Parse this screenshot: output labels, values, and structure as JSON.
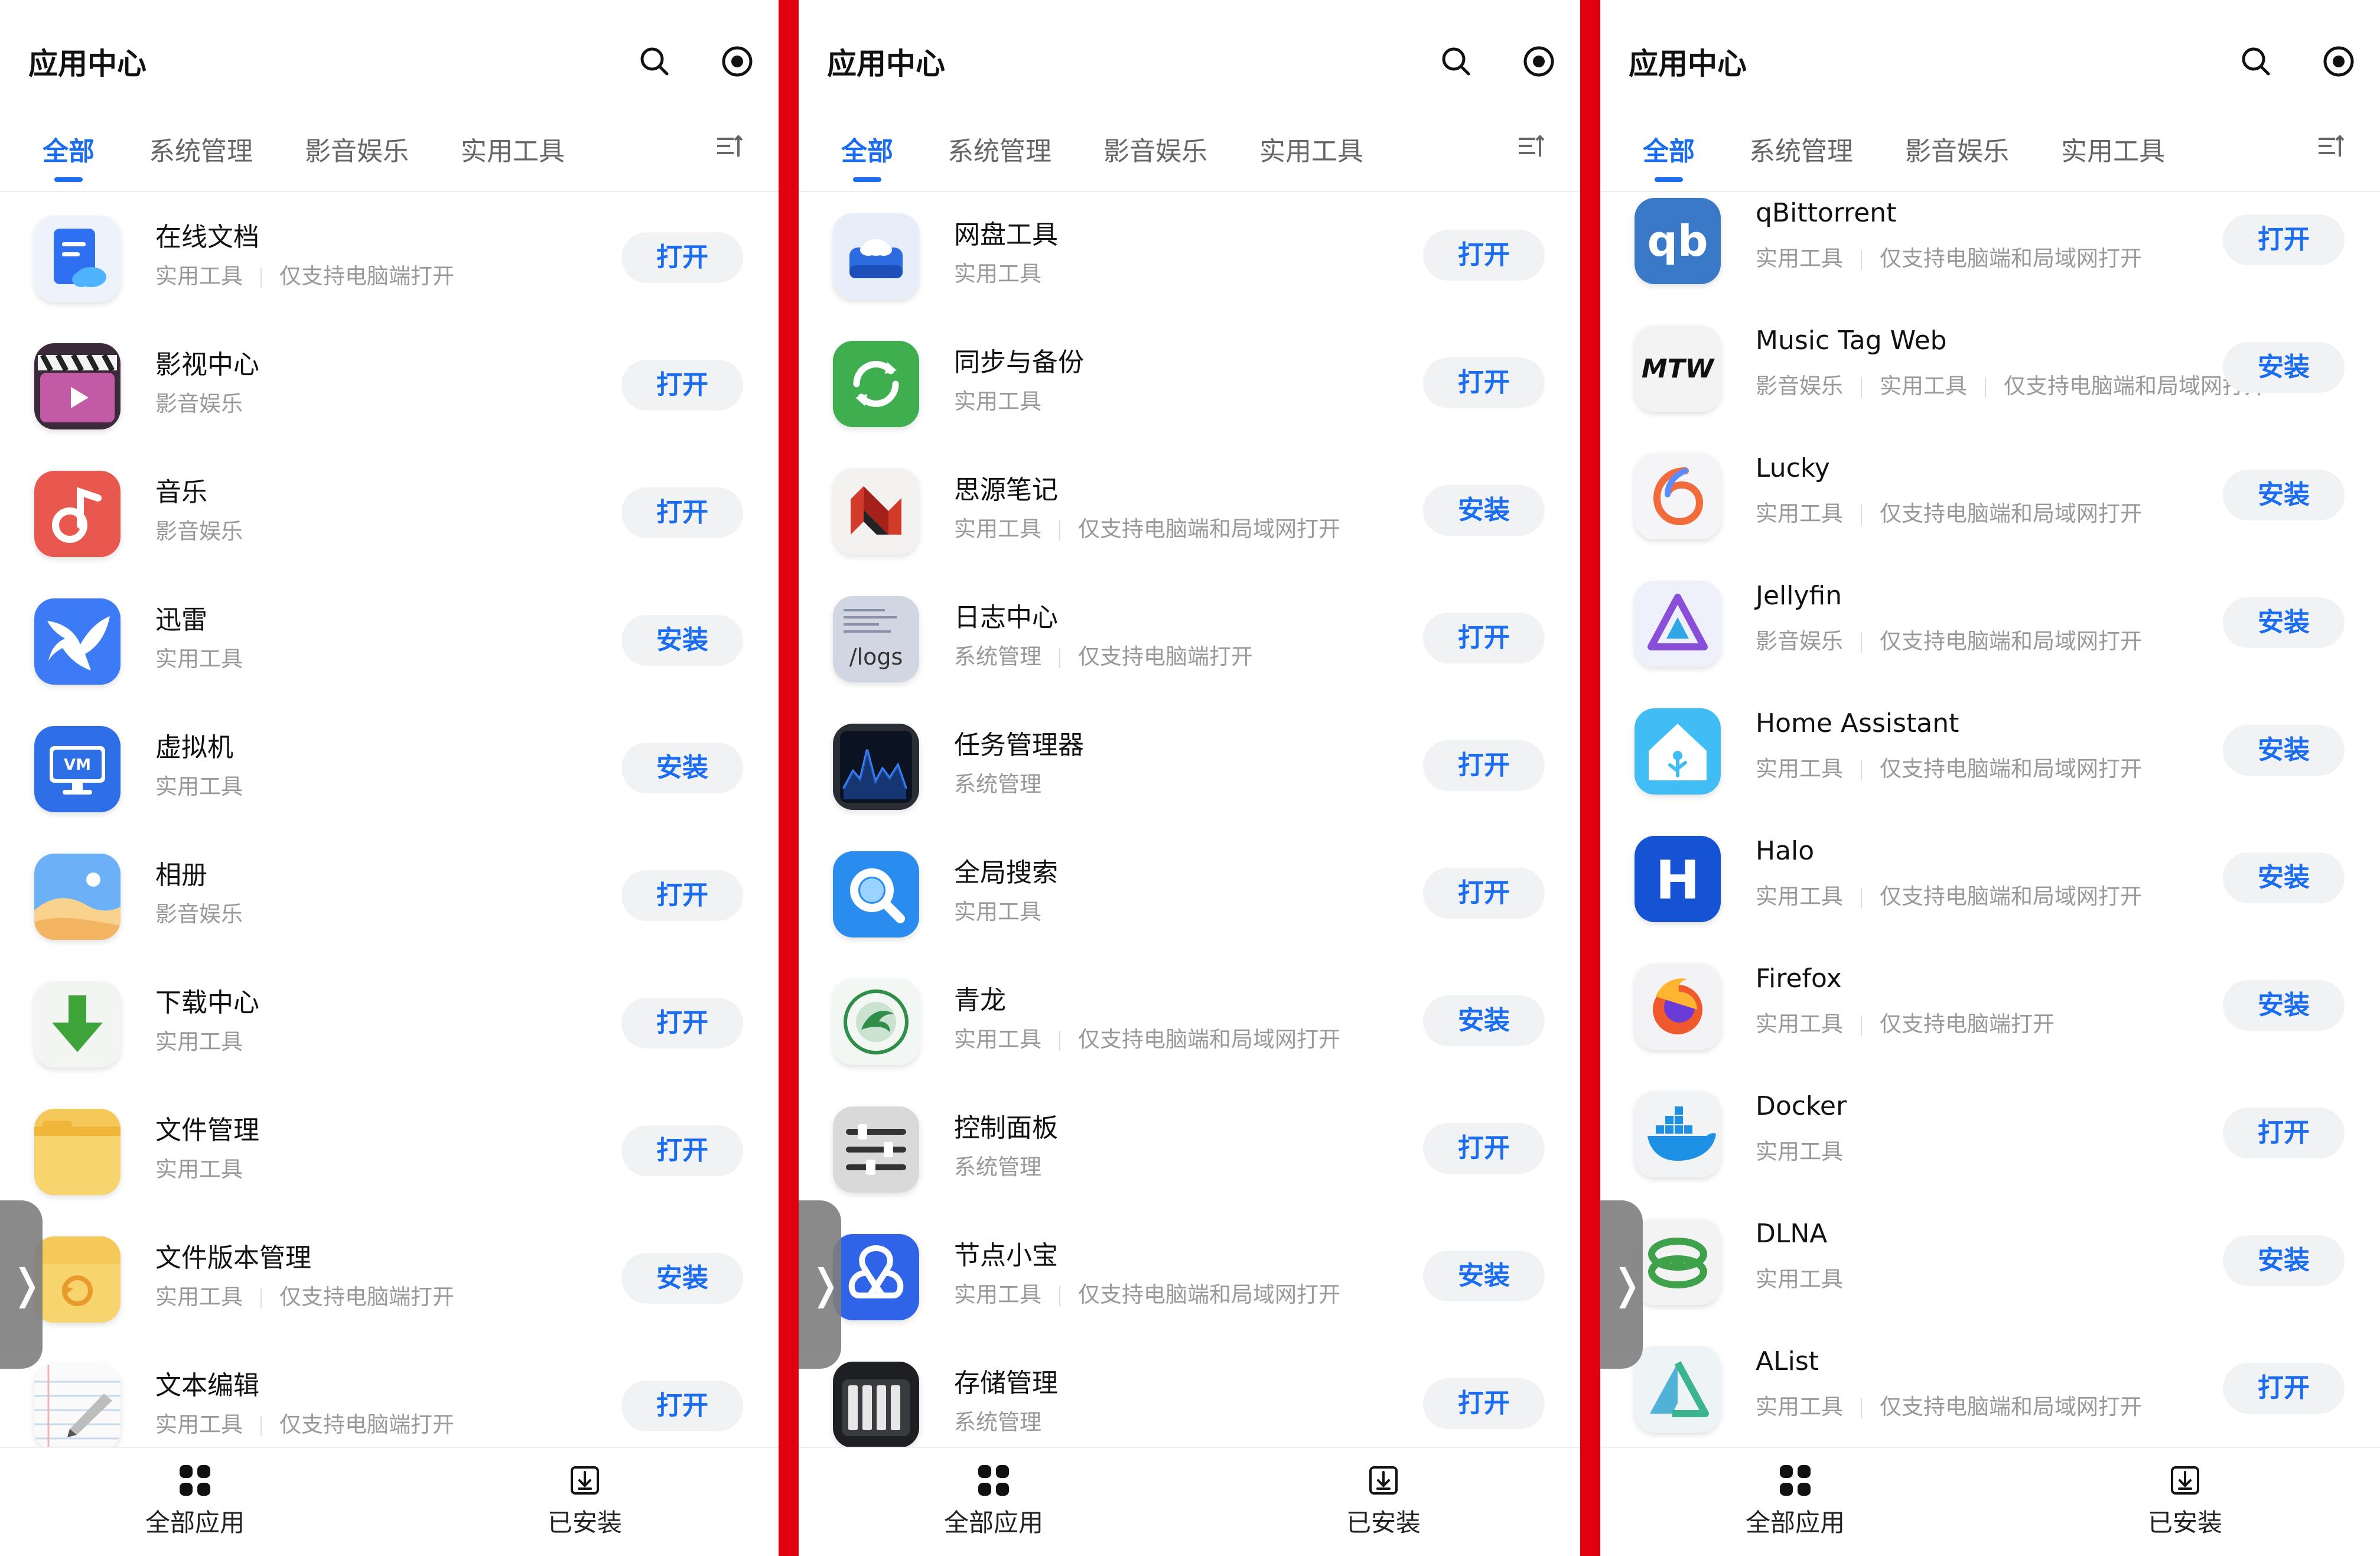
{
  "panels": [
    {
      "title": "应用中心",
      "tabs": [
        "全部",
        "系统管理",
        "影音娱乐",
        "实用工具"
      ],
      "apps": [
        {
          "name": "在线文档",
          "meta": [
            "实用工具",
            "仅支持电脑端打开"
          ],
          "button": "打开",
          "icon": "doc-icon"
        },
        {
          "name": "影视中心",
          "meta": [
            "影音娱乐"
          ],
          "button": "打开",
          "icon": "video-icon"
        },
        {
          "name": "音乐",
          "meta": [
            "影音娱乐"
          ],
          "button": "打开",
          "icon": "music-icon"
        },
        {
          "name": "迅雷",
          "meta": [
            "实用工具"
          ],
          "button": "安装",
          "icon": "thunder-bird-icon"
        },
        {
          "name": "虚拟机",
          "meta": [
            "实用工具"
          ],
          "button": "安装",
          "icon": "vm-icon"
        },
        {
          "name": "相册",
          "meta": [
            "影音娱乐"
          ],
          "button": "打开",
          "icon": "photo-icon"
        },
        {
          "name": "下载中心",
          "meta": [
            "实用工具"
          ],
          "button": "打开",
          "icon": "download-arrow-icon"
        },
        {
          "name": "文件管理",
          "meta": [
            "实用工具"
          ],
          "button": "打开",
          "icon": "folder-icon"
        },
        {
          "name": "文件版本管理",
          "meta": [
            "实用工具",
            "仅支持电脑端打开"
          ],
          "button": "安装",
          "icon": "folder-history-icon"
        },
        {
          "name": "文本编辑",
          "meta": [
            "实用工具",
            "仅支持电脑端打开"
          ],
          "button": "打开",
          "icon": "notepad-icon"
        }
      ]
    },
    {
      "title": "应用中心",
      "tabs": [
        "全部",
        "系统管理",
        "影音娱乐",
        "实用工具"
      ],
      "apps": [
        {
          "name": "网盘工具",
          "meta": [
            "实用工具"
          ],
          "button": "打开",
          "icon": "cloud-drive-icon"
        },
        {
          "name": "同步与备份",
          "meta": [
            "实用工具"
          ],
          "button": "打开",
          "icon": "sync-icon"
        },
        {
          "name": "思源笔记",
          "meta": [
            "实用工具",
            "仅支持电脑端和局域网打开"
          ],
          "button": "安装",
          "icon": "siyuan-icon"
        },
        {
          "name": "日志中心",
          "meta": [
            "系统管理",
            "仅支持电脑端打开"
          ],
          "button": "打开",
          "icon": "logs-icon",
          "icon_text": "/logs"
        },
        {
          "name": "任务管理器",
          "meta": [
            "系统管理"
          ],
          "button": "打开",
          "icon": "activity-monitor-icon"
        },
        {
          "name": "全局搜索",
          "meta": [
            "实用工具"
          ],
          "button": "打开",
          "icon": "search-app-icon"
        },
        {
          "name": "青龙",
          "meta": [
            "实用工具",
            "仅支持电脑端和局域网打开"
          ],
          "button": "安装",
          "icon": "qinglong-icon"
        },
        {
          "name": "控制面板",
          "meta": [
            "系统管理"
          ],
          "button": "打开",
          "icon": "sliders-icon"
        },
        {
          "name": "节点小宝",
          "meta": [
            "实用工具",
            "仅支持电脑端和局域网打开"
          ],
          "button": "安装",
          "icon": "node-icon"
        },
        {
          "name": "存储管理",
          "meta": [
            "系统管理"
          ],
          "button": "打开",
          "icon": "storage-icon"
        }
      ]
    },
    {
      "title": "应用中心",
      "tabs": [
        "全部",
        "系统管理",
        "影音娱乐",
        "实用工具"
      ],
      "apps": [
        {
          "name": "qBittorrent",
          "meta": [
            "实用工具",
            "仅支持电脑端和局域网打开"
          ],
          "button": "打开",
          "icon": "qbittorrent-icon",
          "icon_text": "qb"
        },
        {
          "name": "Music Tag Web",
          "meta": [
            "影音娱乐",
            "实用工具",
            "仅支持电脑端和局域网打开"
          ],
          "button": "安装",
          "icon": "music-tag-icon",
          "icon_text": "MTW"
        },
        {
          "name": "Lucky",
          "meta": [
            "实用工具",
            "仅支持电脑端和局域网打开"
          ],
          "button": "安装",
          "icon": "lucky-icon"
        },
        {
          "name": "Jellyfin",
          "meta": [
            "影音娱乐",
            "仅支持电脑端和局域网打开"
          ],
          "button": "安装",
          "icon": "jellyfin-icon"
        },
        {
          "name": "Home Assistant",
          "meta": [
            "实用工具",
            "仅支持电脑端和局域网打开"
          ],
          "button": "安装",
          "icon": "home-assistant-icon"
        },
        {
          "name": "Halo",
          "meta": [
            "实用工具",
            "仅支持电脑端和局域网打开"
          ],
          "button": "安装",
          "icon": "halo-icon",
          "icon_text": "H"
        },
        {
          "name": "Firefox",
          "meta": [
            "实用工具",
            "仅支持电脑端打开"
          ],
          "button": "安装",
          "icon": "firefox-icon"
        },
        {
          "name": "Docker",
          "meta": [
            "实用工具"
          ],
          "button": "打开",
          "icon": "docker-icon"
        },
        {
          "name": "DLNA",
          "meta": [
            "实用工具"
          ],
          "button": "安装",
          "icon": "dlna-icon"
        },
        {
          "name": "AList",
          "meta": [
            "实用工具",
            "仅支持电脑端和局域网打开"
          ],
          "button": "打开",
          "icon": "alist-icon"
        }
      ]
    }
  ],
  "bottom_nav": {
    "all_apps": "全部应用",
    "installed": "已安装"
  },
  "side_handle": "❭",
  "colors": {
    "accent": "#1a6cf0",
    "divider": "#e00010",
    "button_bg": "#f1f2f4"
  }
}
